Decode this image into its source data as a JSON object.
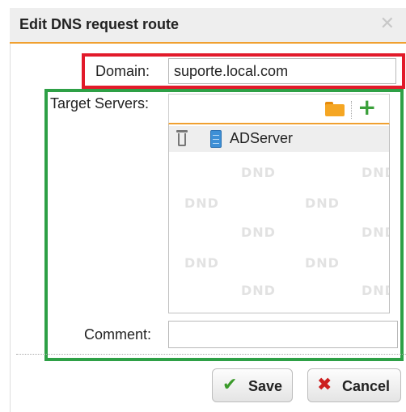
{
  "dialog": {
    "title": "Edit DNS request route",
    "close_symbol": "✕"
  },
  "domain": {
    "label": "Domain:",
    "value": "suporte.local.com"
  },
  "target_servers": {
    "label": "Target Servers:",
    "items": [
      {
        "name": "ADServer",
        "icon": "server-icon"
      }
    ],
    "watermark": "DND",
    "icons": {
      "folder": "folder-icon",
      "add": "plus-icon",
      "remove": "trash-icon"
    }
  },
  "comment": {
    "label": "Comment:",
    "value": ""
  },
  "buttons": {
    "save": {
      "label": "Save",
      "icon_symbol": "✔",
      "icon": "check-icon"
    },
    "cancel": {
      "label": "Cancel",
      "icon_symbol": "✖",
      "icon": "x-icon"
    }
  },
  "colors": {
    "highlight_red": "#e21a2a",
    "highlight_green": "#2ea046",
    "accent_orange": "#f0a030",
    "check_green": "#3a9a2a",
    "cancel_red": "#cc1e1e"
  }
}
